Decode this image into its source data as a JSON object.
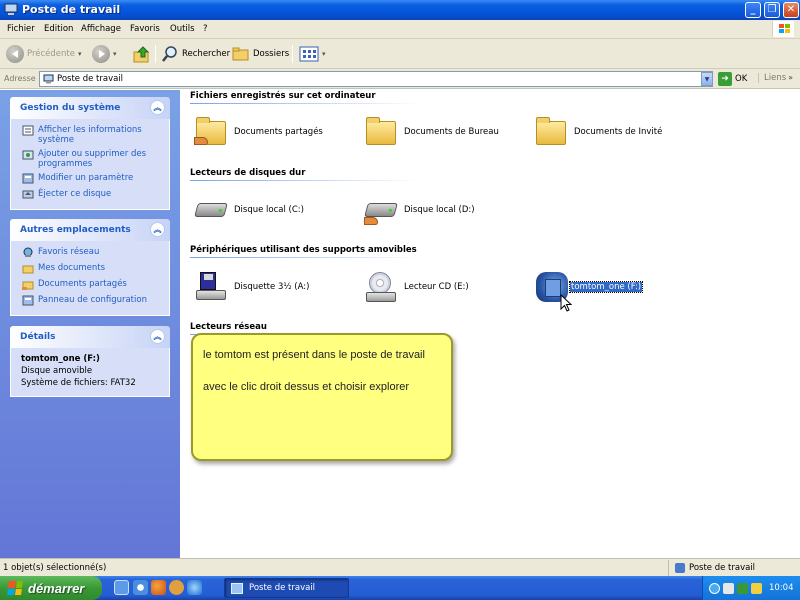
{
  "window": {
    "title": "Poste de travail"
  },
  "menu": [
    "Fichier",
    "Edition",
    "Affichage",
    "Favoris",
    "Outils",
    "?"
  ],
  "toolbar": {
    "back_label": "Précédente",
    "search_label": "Rechercher",
    "folders_label": "Dossiers"
  },
  "address": {
    "label": "Adresse",
    "value": "Poste de travail",
    "go_label": "OK",
    "links_label": "Liens"
  },
  "left_panels": {
    "system": {
      "title": "Gestion du système",
      "tasks": [
        "Afficher les informations système",
        "Ajouter ou supprimer des programmes",
        "Modifier un paramètre",
        "Éjecter ce disque"
      ]
    },
    "places": {
      "title": "Autres emplacements",
      "tasks": [
        "Favoris réseau",
        "Mes documents",
        "Documents partagés",
        "Panneau de configuration"
      ]
    },
    "details": {
      "title": "Détails",
      "name": "tomtom_one (F:)",
      "type": "Disque amovible",
      "fs": "Système de fichiers: FAT32"
    }
  },
  "sections": {
    "files": {
      "title": "Fichiers enregistrés sur cet ordinateur",
      "items": [
        "Documents partagés",
        "Documents de Bureau",
        "Documents de Invité"
      ]
    },
    "hard_drives": {
      "title": "Lecteurs de disques dur",
      "items": [
        "Disque local (C:)",
        "Disque local (D:)"
      ]
    },
    "removable": {
      "title": "Périphériques utilisant des supports amovibles",
      "items": [
        "Disquette 3½ (A:)",
        "Lecteur CD (E:)",
        "tomtom_one (F:)"
      ]
    },
    "network": {
      "title": "Lecteurs réseau"
    }
  },
  "note": {
    "line1": "le tomtom est présent dans le poste de travail",
    "line2": "avec le clic droit dessus et choisir explorer"
  },
  "status": {
    "left": "1 objet(s) sélectionné(s)",
    "right": "Poste de travail"
  },
  "taskbar": {
    "start_label": "démarrer",
    "task_label": "Poste de travail",
    "clock": "10:04"
  },
  "colors": {
    "title_blue": "#0552d8",
    "link_blue": "#215dc6",
    "selection": "#316ac5",
    "note_yellow": "#ffff80",
    "start_green": "#3a9936"
  }
}
